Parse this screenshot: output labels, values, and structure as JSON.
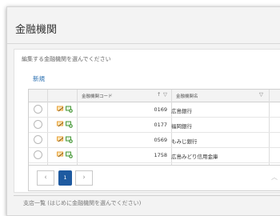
{
  "window": {
    "title": "金融機関"
  },
  "instruction": "編集する金融機関を選んでください",
  "new_link": "新規",
  "grid": {
    "columns": [
      {
        "label": "",
        "icons": []
      },
      {
        "label": "",
        "icons": []
      },
      {
        "label": "金融機関コード",
        "icons": [
          "sort-asc-icon",
          "filter-icon"
        ]
      },
      {
        "label": "金融機関名",
        "icons": [
          "filter-icon"
        ]
      }
    ],
    "rows": [
      {
        "code": "0169",
        "name": "広島銀行"
      },
      {
        "code": "0177",
        "name": "福岡銀行"
      },
      {
        "code": "0569",
        "name": "もみじ銀行"
      },
      {
        "code": "1758",
        "name": "広島みどり信用金庫"
      }
    ],
    "row_actions": [
      "edit-icon",
      "add-icon"
    ]
  },
  "pager": {
    "prev": "‹",
    "current_page": "1",
    "next": "›",
    "collapse": "︿"
  },
  "footer": "支店一覧 (はじめに金融機関を選んでください)",
  "colors": {
    "accent": "#1e5aa0",
    "link": "#2a6fb0",
    "icon_orange": "#e8a33c",
    "icon_green": "#4a9a3c"
  }
}
